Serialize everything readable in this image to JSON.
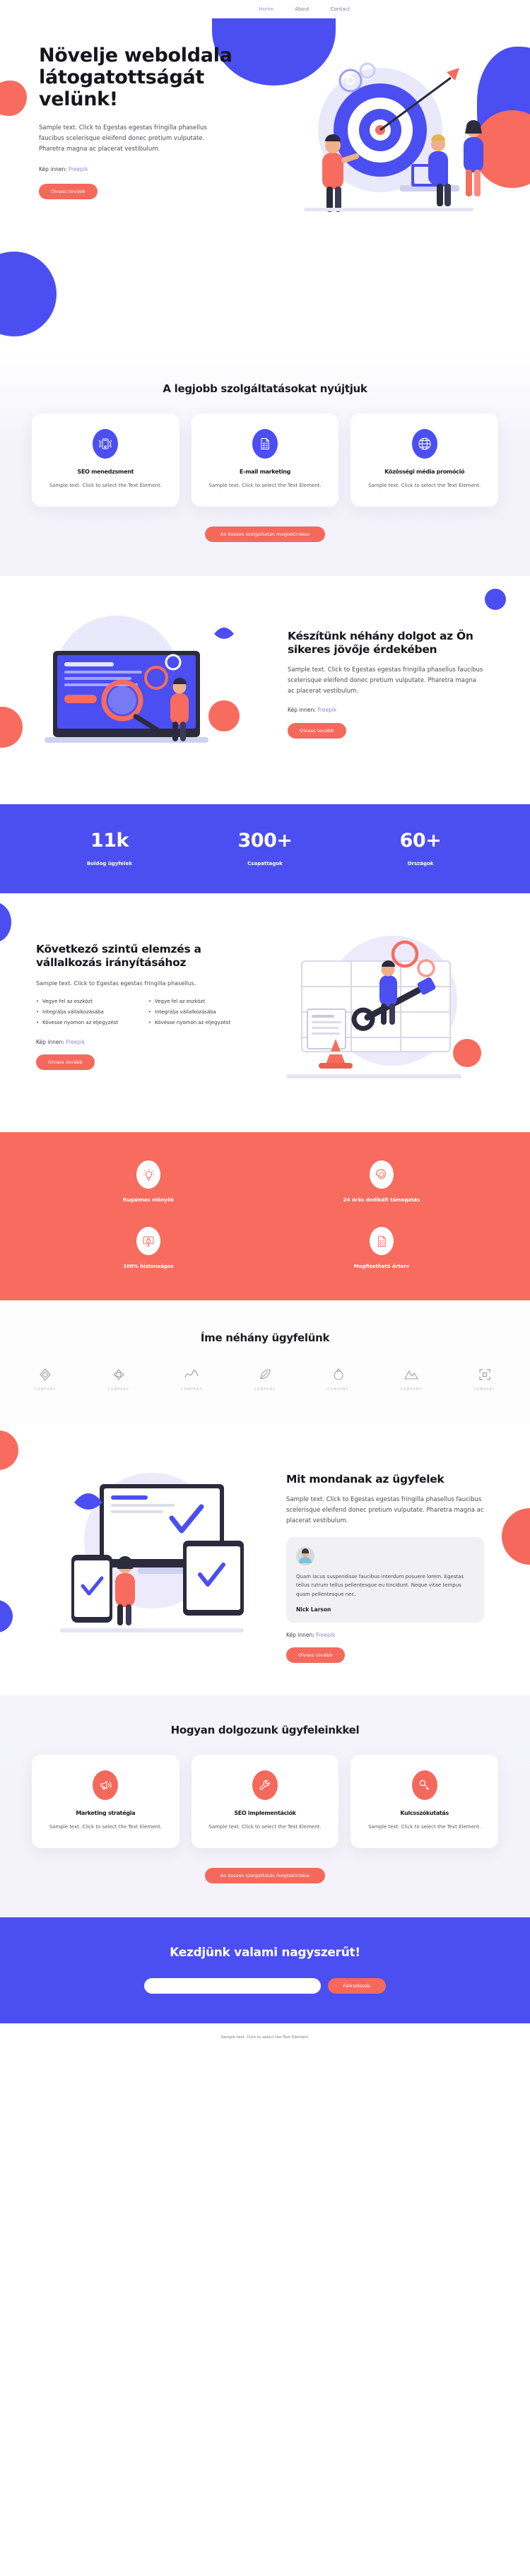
{
  "nav": {
    "items": [
      {
        "label": "Home",
        "active": true
      },
      {
        "label": "About",
        "active": false
      },
      {
        "label": "Contact",
        "active": false
      }
    ]
  },
  "hero": {
    "title": "Növelje weboldala látogatottságát velünk!",
    "body": "Sample text. Click to Egestas egestas fringilla phasellus faucibus scelerisque eleifend donec pretium vulputate. Pharetra magna ac placerat vestibulum.",
    "credit_label": "Kép innen:",
    "credit_link": "Freepik",
    "cta": "Olvass tovább"
  },
  "services": {
    "title": "A legjobb szolgáltatásokat nyújtjuk",
    "cards": [
      {
        "icon": "mobile-signal-icon",
        "title": "SEO menedzsment",
        "body": "Sample text. Click to select the Text Element."
      },
      {
        "icon": "checklist-document-icon",
        "title": "E-mail marketing",
        "body": "Sample text. Click to select the Text Element."
      },
      {
        "icon": "globe-icon",
        "title": "Közösségi média promóció",
        "body": "Sample text. Click to select the Text Element."
      }
    ],
    "cta": "Az összes szolgáltatás megtekintése"
  },
  "about": {
    "title": "Készítünk néhány dolgot az Ön sikeres jövője érdekében",
    "body": "Sample text. Click to Egestas egestas fringilla phasellus faucibus scelerisque eleifend donec pretium vulputate. Pharetra magna ac placerat vestibulum.",
    "credit_label": "Kép innen:",
    "credit_link": "Freepik",
    "cta": "Olvass tovább"
  },
  "stats": {
    "items": [
      {
        "value": "11k",
        "label": "Boldog ügyfelek"
      },
      {
        "value": "300+",
        "label": "Csapattagok"
      },
      {
        "value": "60+",
        "label": "Országok"
      }
    ]
  },
  "analytics": {
    "title": "Következő szintű elemzés a vállalkozás irányításához",
    "body": "Sample text. Click to Egestas egestas fringilla phasellus.",
    "list_left": [
      "Vegye fel az eszközt",
      "Integrálja vállalkozásába",
      "Kövesse nyomon az eljegyzést"
    ],
    "list_right": [
      "Vegye fel az eszközt",
      "Integrálja vállalkozásába",
      "Kövesse nyomon az eljegyzést"
    ],
    "credit_label": "Kép innen:",
    "credit_link": "Freepik",
    "cta": "Olvass tovább"
  },
  "features": {
    "items": [
      {
        "icon": "lightbulb-icon",
        "label": "Rugalmas előnyök"
      },
      {
        "icon": "gear-icon",
        "label": "24 órás dedikált támogatás"
      },
      {
        "icon": "monitor-lock-icon",
        "label": "100% biztonságos"
      },
      {
        "icon": "price-list-icon",
        "label": "Megfizethető árterv"
      }
    ]
  },
  "clients": {
    "title": "Íme néhány ügyfelünk",
    "logos": [
      {
        "icon": "diamond-outline-icon",
        "name": "COMPANY"
      },
      {
        "icon": "flower-icon",
        "name": "COMPANY"
      },
      {
        "icon": "wave-icon",
        "name": "COMPANY"
      },
      {
        "icon": "leaf-icon",
        "name": "COMPANY"
      },
      {
        "icon": "ring-icon",
        "name": "COMPANY"
      },
      {
        "icon": "mountain-icon",
        "name": "COMPANY"
      },
      {
        "icon": "bracket-icon",
        "name": "COMPANY"
      }
    ]
  },
  "testimonials": {
    "title": "Mit mondanak az ügyfelek",
    "body": "Sample text. Click to Egestas egestas fringilla phasellus faucibus scelerisque eleifend donec pretium vulputate. Pharetra magna ac placerat vestibulum.",
    "quote": "Quam lacus suspendisse faucibus interdum posuere lorem. Egestas tellus rutrum tellus pellentesque eu tincidunt. Neque vitae tempus quam pellentesque nec.",
    "author": "Nick Larson",
    "credit_label": "Kép innen:",
    "credit_link": "Freepik",
    "cta": "Olvass tovább"
  },
  "process": {
    "title": "Hogyan dolgozunk ügyfeleinkkel",
    "cards": [
      {
        "icon": "megaphone-icon",
        "title": "Marketing stratégia",
        "body": "Sample text. Click to select the Text Element."
      },
      {
        "icon": "wrench-icon",
        "title": "SEO implementációk",
        "body": "Sample text. Click to select the Text Element."
      },
      {
        "icon": "key-icon",
        "title": "Kulcsszókutatás",
        "body": "Sample text. Click to select the Text Element."
      }
    ],
    "cta": "Az összes szolgáltatás megtekintése"
  },
  "cta": {
    "title": "Kezdjünk valami nagyszerűt!",
    "input_placeholder": "",
    "input_value": "",
    "button": "Feliratkozás"
  },
  "footer": {
    "text": "Sample text. Click to select the Text Element."
  },
  "colors": {
    "brand_blue": "#4b4ef0",
    "brand_coral": "#f76c5e",
    "ink": "#15151c"
  }
}
